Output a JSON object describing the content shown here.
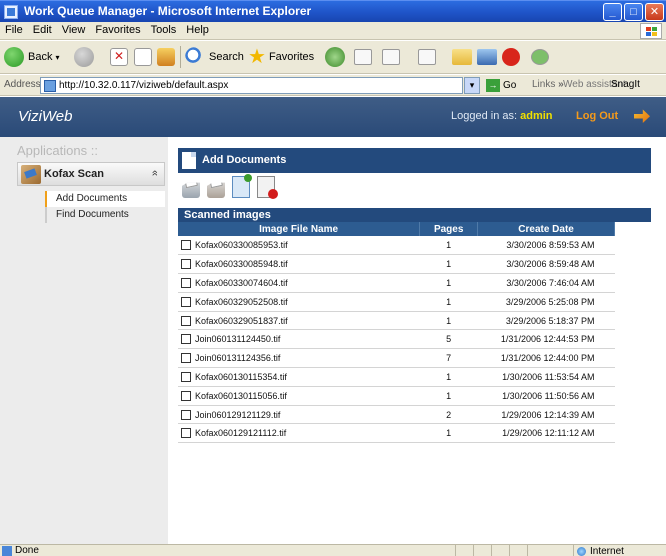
{
  "window": {
    "title": "Work Queue Manager - Microsoft Internet Explorer",
    "btn_min": "_",
    "btn_max": "□",
    "btn_close": "✕"
  },
  "menu": [
    "File",
    "Edit",
    "View",
    "Favorites",
    "Tools",
    "Help"
  ],
  "toolbar": {
    "back": "Back",
    "search": "Search",
    "favorites": "Favorites",
    "dropdown": "▾",
    "fav_star": "★"
  },
  "address": {
    "label": "Address",
    "url": "http://10.32.0.117/viziweb/default.aspx",
    "go": "Go",
    "go_arrow": "→",
    "links": "Links",
    "links_chevron": "»",
    "web_assistant": "Web assistant",
    "snagit": "SnagIt",
    "drop": "▾"
  },
  "app": {
    "brand": "ViziWeb",
    "logged_in_label": "Logged in as:",
    "username": "admin",
    "logout": "Log Out"
  },
  "sidebar": {
    "title": "Applications ::",
    "group": "Kofax Scan",
    "collapse": "»",
    "items": [
      "Add Documents",
      "Find Documents"
    ]
  },
  "panel": {
    "title": "Add Documents",
    "section": "Scanned images",
    "columns": [
      "Image File Name",
      "Pages",
      "Create Date"
    ],
    "rows": [
      {
        "name": "Kofax060330085953.tif",
        "pages": "1",
        "date": "3/30/2006 8:59:53 AM"
      },
      {
        "name": "Kofax060330085948.tif",
        "pages": "1",
        "date": "3/30/2006 8:59:48 AM"
      },
      {
        "name": "Kofax060330074604.tif",
        "pages": "1",
        "date": "3/30/2006 7:46:04 AM"
      },
      {
        "name": "Kofax060329052508.tif",
        "pages": "1",
        "date": "3/29/2006 5:25:08 PM"
      },
      {
        "name": "Kofax060329051837.tif",
        "pages": "1",
        "date": "3/29/2006 5:18:37 PM"
      },
      {
        "name": "Join060131124450.tif",
        "pages": "5",
        "date": "1/31/2006 12:44:53 PM"
      },
      {
        "name": "Join060131124356.tif",
        "pages": "7",
        "date": "1/31/2006 12:44:00 PM"
      },
      {
        "name": "Kofax060130115354.tif",
        "pages": "1",
        "date": "1/30/2006 11:53:54 AM"
      },
      {
        "name": "Kofax060130115056.tif",
        "pages": "1",
        "date": "1/30/2006 11:50:56 AM"
      },
      {
        "name": "Join060129121129.tif",
        "pages": "2",
        "date": "1/29/2006 12:14:39 AM"
      },
      {
        "name": "Kofax060129121112.tif",
        "pages": "1",
        "date": "1/29/2006 12:11:12 AM"
      }
    ]
  },
  "status": {
    "left": "Done",
    "zone": "Internet"
  }
}
